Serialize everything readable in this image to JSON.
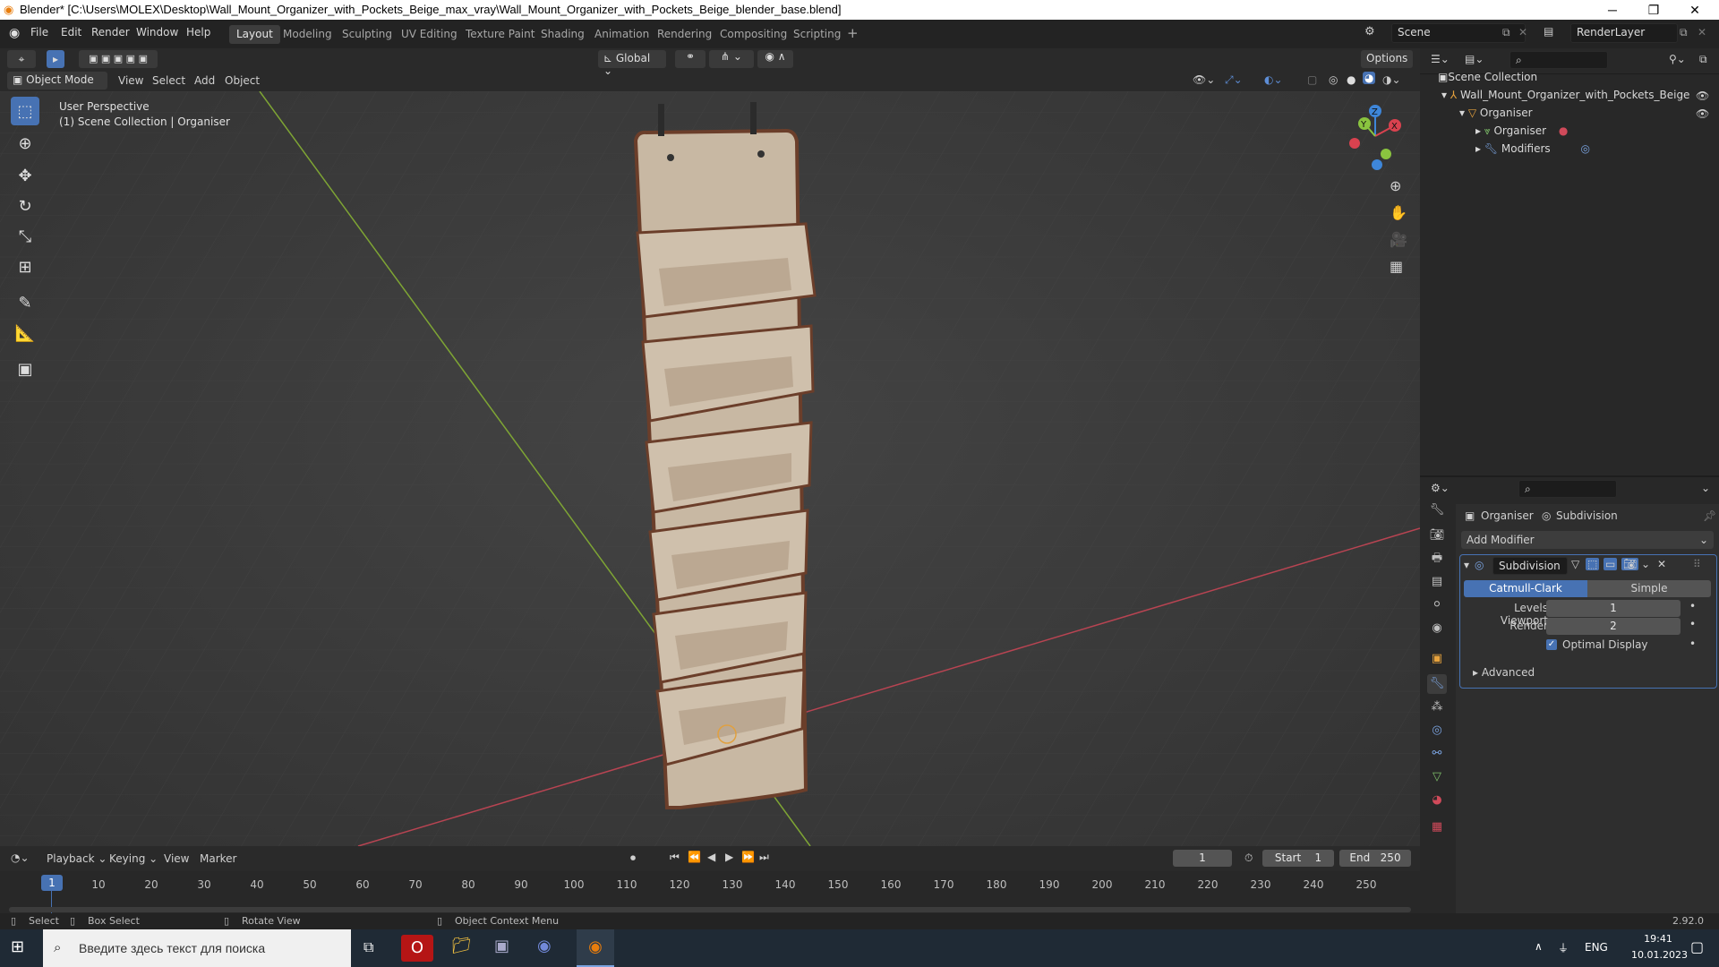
{
  "window": {
    "title": "Blender* [C:\\Users\\MOLEX\\Desktop\\Wall_Mount_Organizer_with_Pockets_Beige_max_vray\\Wall_Mount_Organizer_with_Pockets_Beige_blender_base.blend]"
  },
  "menu": [
    "File",
    "Edit",
    "Render",
    "Window",
    "Help"
  ],
  "workspaces": [
    "Layout",
    "Modeling",
    "Sculpting",
    "UV Editing",
    "Texture Paint",
    "Shading",
    "Animation",
    "Rendering",
    "Compositing",
    "Scripting"
  ],
  "workspace_active": "Layout",
  "scene": {
    "name": "Scene",
    "render_layer": "RenderLayer"
  },
  "viewport_header": {
    "orientation": "Global",
    "options": "Options",
    "mode": "Object Mode",
    "menus": [
      "View",
      "Select",
      "Add",
      "Object"
    ]
  },
  "viewport": {
    "perspective": "User Perspective",
    "collection": "(1) Scene Collection | Organiser"
  },
  "outliner": {
    "root": "Scene Collection",
    "items": [
      {
        "label": "Wall_Mount_Organizer_with_Pockets_Beige"
      },
      {
        "label": "Organiser"
      },
      {
        "label": "Organiser"
      },
      {
        "label": "Modifiers"
      }
    ]
  },
  "properties": {
    "breadcrumb_object": "Organiser",
    "breadcrumb_modifier": "Subdivision",
    "add_modifier": "Add Modifier",
    "modifier_name": "Subdivision",
    "type_options": [
      "Catmull-Clark",
      "Simple"
    ],
    "type_selected": "Catmull-Clark",
    "levels_viewport_label": "Levels Viewport",
    "levels_viewport": "1",
    "render_label": "Render",
    "render": "2",
    "optimal_display_label": "Optimal Display",
    "optimal_display": true,
    "advanced": "Advanced"
  },
  "timeline": {
    "menus": [
      "Playback",
      "Keying",
      "View",
      "Marker"
    ],
    "current_frame": "1",
    "start_label": "Start",
    "start": "1",
    "end_label": "End",
    "end": "250",
    "current_marker": "1",
    "ticks": [
      "10",
      "20",
      "30",
      "40",
      "50",
      "60",
      "70",
      "80",
      "90",
      "100",
      "110",
      "120",
      "130",
      "140",
      "150",
      "160",
      "170",
      "180",
      "190",
      "200",
      "210",
      "220",
      "230",
      "240",
      "250"
    ]
  },
  "statusbar": {
    "select": "Select",
    "box_select": "Box Select",
    "rotate_view": "Rotate View",
    "context_menu": "Object Context Menu",
    "version": "2.92.0"
  },
  "taskbar": {
    "search_placeholder": "Введите здесь текст для поиска",
    "language": "ENG",
    "time": "19:41",
    "date": "10.01.2023"
  },
  "colors": {
    "accent": "#4772b3",
    "x_axis": "#d9424f",
    "y_axis": "#8ac43f",
    "z_axis": "#3e86d9",
    "organizer_fabric": "#c9b9a5",
    "organizer_trim": "#6b3e2a"
  }
}
